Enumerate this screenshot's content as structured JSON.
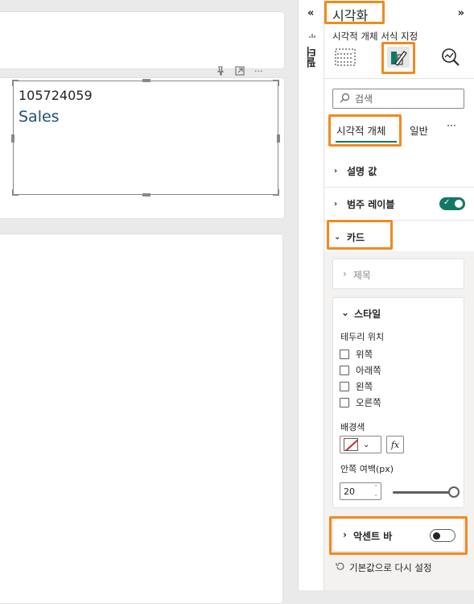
{
  "canvas": {
    "card_value": "105724059",
    "card_label": "Sales"
  },
  "visual_header": {
    "pin_icon": "pin-icon",
    "focus_icon": "focus-mode-icon",
    "more_icon": "more-options-icon"
  },
  "filters": {
    "collapse_glyph": "«",
    "label": "필터"
  },
  "pane": {
    "title": "시각화",
    "expand_glyph": "»",
    "subtitle": "시각적 개체 서식 지정",
    "search_placeholder": "검색",
    "tabs": [
      {
        "label": "시각적 개체"
      },
      {
        "label": "일반"
      },
      {
        "label": "···"
      }
    ],
    "sections": [
      {
        "label": "설명 값"
      },
      {
        "label": "범주 레이블"
      },
      {
        "label": "카드"
      }
    ],
    "card": {
      "title_section": "제목",
      "style_section": "스타일",
      "border_position_label": "테두리 위치",
      "border_options": [
        "위쪽",
        "아래쪽",
        "왼쪽",
        "오른쪽"
      ],
      "background_color_label": "배경색",
      "fx_label": "fx",
      "padding_label": "안쪽 여백(px)",
      "padding_value": "20",
      "accent_bar": "악센트 바"
    },
    "reset_label": "기본값으로 다시 설정"
  },
  "colors": {
    "accent_orange": "#f28a1c",
    "toggle_green": "#117865",
    "sales_label": "#1e4e79"
  }
}
